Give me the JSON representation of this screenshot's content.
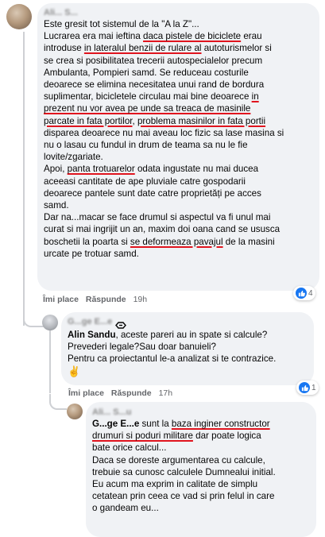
{
  "comment1": {
    "author": "Ali... S...",
    "lines": [
      [
        "Este gresit tot sistemul de la \"A la Z\"..."
      ],
      [
        "Lucrarea era mai ieftina ",
        {
          "u": "daca pistele de biciclete"
        },
        " erau"
      ],
      [
        "introduse ",
        {
          "u": "in lateralul benzii de rulare al"
        },
        " autoturismelor si"
      ],
      [
        "se crea si posibilitatea trecerii autospecialelor precum"
      ],
      [
        "Ambulanta, Pompieri samd. Se reduceau costurile"
      ],
      [
        "deoarece se elimina necesitatea unui rand de bordura"
      ],
      [
        "suplimentar, bicicletele circulau mai bine deoarece ",
        {
          "u": "in"
        }
      ],
      [
        {
          "u": "prezent nu vor avea pe unde sa treaca de masinile"
        }
      ],
      [
        {
          "u": "parcate in fata portilor"
        },
        ", ",
        {
          "u": "problema masinilor in fata portii"
        }
      ],
      [
        "disparea deoarece nu mai aveau loc fizic sa lase masina si"
      ],
      [
        "nu o lasau cu fundul in drum de teama sa nu le fie"
      ],
      [
        "lovite/zgariate."
      ],
      [
        "Apoi, ",
        {
          "u": "panta trotuarelor"
        },
        " odata ingustate nu mai ducea"
      ],
      [
        "aceeasi cantitate de ape pluviale catre gospodarii"
      ],
      [
        "deoarece pantele sunt date catre proprietăți pe acces"
      ],
      [
        "samd."
      ],
      [
        "Dar na...macar se face drumul si aspectul va fi unul mai"
      ],
      [
        "curat si mai ingrijit un an, maxim doi oana cand se ususca"
      ],
      [
        "boschetii la poarta si ",
        {
          "u": "se deformeaza pavajul"
        },
        " de la masini"
      ],
      [
        "urcate pe trotuar samd."
      ]
    ],
    "like_label": "Îmi place",
    "reply_label": "Răspunde",
    "time": "19h",
    "reaction_count": "4"
  },
  "comment2": {
    "author": "G...ge E...e",
    "lines": [
      [
        {
          "b": "Alin Sandu"
        },
        ", aceste pareri au in spate si calcule?"
      ],
      [
        "Prevederi legale?Sau doar banuieli?"
      ],
      [
        "Pentru ca proiectantul le-a analizat si te contrazice."
      ]
    ],
    "emoji": "✌",
    "like_label": "Îmi place",
    "reply_label": "Răspunde",
    "time": "17h",
    "reaction_count": "1"
  },
  "comment3": {
    "author": "Ali... S...u",
    "lines": [
      [
        {
          "b": "G...ge E...e"
        },
        " sunt la ",
        {
          "u": "baza inginer constructor"
        }
      ],
      [
        {
          "u": "drumuri si poduri militare"
        },
        " dar poate logica"
      ],
      [
        "bate orice calcul..."
      ],
      [
        "Daca se doreste argumentarea cu calcule,"
      ],
      [
        "trebuie sa cunosc calculele Dumnealui initial."
      ],
      [
        "Eu acum ma exprim in calitate de simplu"
      ],
      [
        "cetatean prin ceea ce vad si prin felul in care"
      ],
      [
        "o gandeam eu..."
      ]
    ]
  },
  "colors": {
    "accent": "#1877f2",
    "underline": "#e0141e",
    "bubble": "#f0f2f5",
    "meta": "#65676b"
  },
  "icons": {
    "reaction": "like-icon",
    "badge": "top-fan-badge-icon"
  }
}
